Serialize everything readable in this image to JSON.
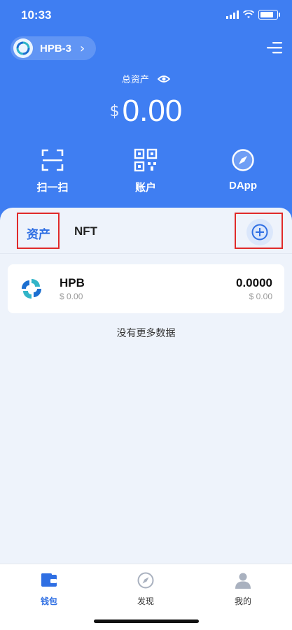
{
  "status_bar": {
    "time": "10:33"
  },
  "header": {
    "wallet_name": "HPB-3",
    "wallet_chevron": "›"
  },
  "balance": {
    "label": "总资产",
    "currency_symbol": "$",
    "amount": "0.00"
  },
  "actions": [
    {
      "label": "扫一扫",
      "icon": "scan-icon"
    },
    {
      "label": "账户",
      "icon": "qr-code-icon"
    },
    {
      "label": "DApp",
      "icon": "compass-icon"
    }
  ],
  "tabs": [
    {
      "label": "资产",
      "active": true
    },
    {
      "label": "NFT",
      "active": false
    }
  ],
  "assets": [
    {
      "symbol": "HPB",
      "value_usd": "$ 0.00",
      "balance": "0.0000",
      "balance_usd": "$ 0.00"
    }
  ],
  "empty_message": "没有更多数据",
  "bottom_nav": [
    {
      "label": "钱包",
      "icon": "wallet-icon",
      "active": true
    },
    {
      "label": "发现",
      "icon": "compass-icon",
      "active": false
    },
    {
      "label": "我的",
      "icon": "user-icon",
      "active": false
    }
  ],
  "colors": {
    "primary": "#3f7ef2",
    "active": "#2f6fe3",
    "highlight": "#e02a2a",
    "background": "#eef3fb"
  }
}
